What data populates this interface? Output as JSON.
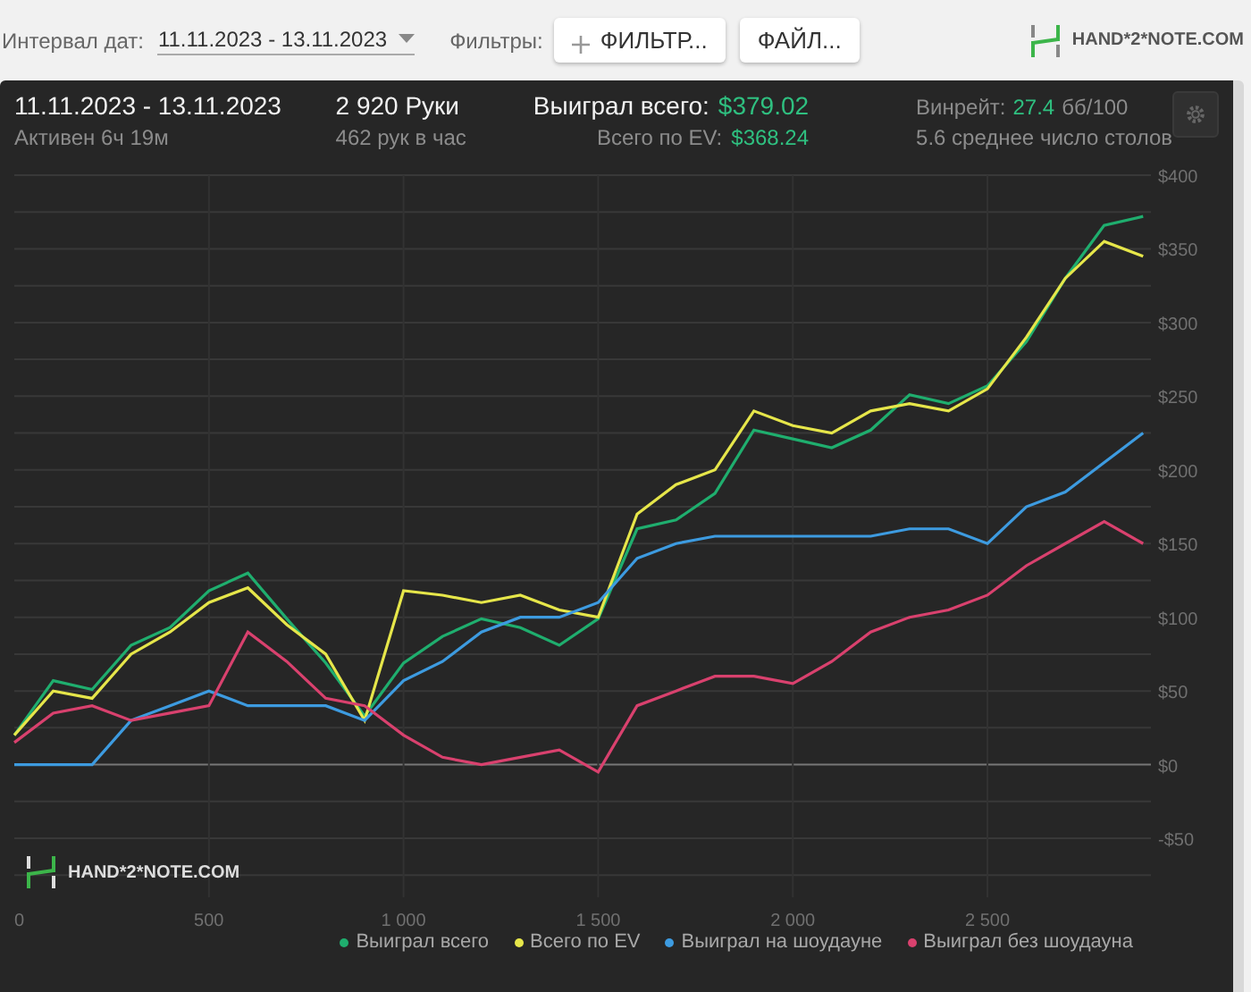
{
  "toolbar": {
    "date_label": "Интервал дат:",
    "date_range": "11.11.2023 - 13.11.2023",
    "filters_label": "Фильтры:",
    "filter_button": "ФИЛЬТР...",
    "file_button": "ФАЙЛ...",
    "logo": "HAND*2*NOTE.COM"
  },
  "summary": {
    "period": "11.11.2023 - 13.11.2023",
    "active": "Активен 6ч 19м",
    "hands": "2 920 Руки",
    "hands_per_hour": "462 рук в час",
    "won_label": "Выиграл всего:",
    "won_value": "$379.02",
    "ev_label": "Всего по EV:",
    "ev_value": "$368.24",
    "winrate_label": "Винрейт:",
    "winrate_value": "27.4",
    "winrate_unit": "бб/100",
    "tables": "5.6 среднее число столов"
  },
  "chart": {
    "watermark": "HAND*2*NOTE.COM",
    "chart_data": {
      "type": "line",
      "x": [
        0,
        100,
        200,
        300,
        400,
        500,
        600,
        700,
        800,
        900,
        1000,
        1100,
        1200,
        1300,
        1400,
        1500,
        1600,
        1700,
        1800,
        1900,
        2000,
        2100,
        2200,
        2300,
        2400,
        2500,
        2600,
        2700,
        2800,
        2900
      ],
      "series": [
        {
          "name": "Выиграл всего",
          "color": "#1fae6e",
          "values": [
            20,
            57,
            51,
            81,
            93,
            118,
            130,
            99,
            69,
            33,
            69,
            87,
            99,
            93,
            81,
            99,
            160,
            166,
            184,
            227,
            221,
            215,
            227,
            251,
            245,
            257,
            287,
            330,
            366,
            372
          ]
        },
        {
          "name": "Всего по EV",
          "color": "#e6e64a",
          "values": [
            20,
            50,
            45,
            75,
            90,
            110,
            120,
            95,
            75,
            30,
            118,
            115,
            110,
            115,
            105,
            100,
            170,
            190,
            200,
            240,
            230,
            225,
            240,
            245,
            240,
            255,
            290,
            330,
            355,
            345
          ]
        },
        {
          "name": "Выиграл на шоудауне",
          "color": "#3d9be0",
          "values": [
            0,
            0,
            0,
            30,
            40,
            50,
            40,
            40,
            40,
            30,
            57,
            70,
            90,
            100,
            100,
            110,
            140,
            150,
            155,
            155,
            155,
            155,
            155,
            160,
            160,
            150,
            175,
            185,
            205,
            225
          ]
        },
        {
          "name": "Выиграл без шоудауна",
          "color": "#d9416e",
          "values": [
            15,
            35,
            40,
            30,
            35,
            40,
            90,
            70,
            45,
            40,
            20,
            5,
            0,
            5,
            10,
            -5,
            40,
            50,
            60,
            60,
            55,
            70,
            90,
            100,
            105,
            115,
            135,
            150,
            165,
            150
          ]
        }
      ],
      "grid": true,
      "xlim": [
        0,
        2920
      ],
      "ylim": [
        -90,
        400
      ],
      "xticks": [
        {
          "value": 0,
          "label": "0"
        },
        {
          "value": 500,
          "label": "500"
        },
        {
          "value": 1000,
          "label": "1 000"
        },
        {
          "value": 1500,
          "label": "1 500"
        },
        {
          "value": 2000,
          "label": "2 000"
        },
        {
          "value": 2500,
          "label": "2 500"
        }
      ],
      "yticks": [
        {
          "value": -50,
          "label": "-$50"
        },
        {
          "value": 0,
          "label": "$0"
        },
        {
          "value": 50,
          "label": "$50"
        },
        {
          "value": 100,
          "label": "$100"
        },
        {
          "value": 150,
          "label": "$150"
        },
        {
          "value": 200,
          "label": "$200"
        },
        {
          "value": 250,
          "label": "$250"
        },
        {
          "value": 300,
          "label": "$300"
        },
        {
          "value": 350,
          "label": "$350"
        },
        {
          "value": 400,
          "label": "$400"
        }
      ]
    }
  }
}
